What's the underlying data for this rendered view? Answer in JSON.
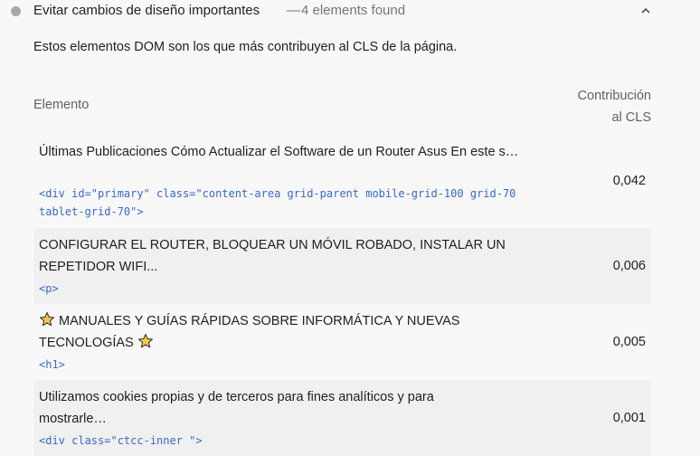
{
  "audit": {
    "title": "Evitar cambios de diseño importantes",
    "separator": "—",
    "count_text": "4 elements found",
    "description": "Estos elementos DOM son los que más contribuyen al CLS de la página."
  },
  "table": {
    "headers": {
      "element": "Elemento",
      "contribution_line1": "Contribución",
      "contribution_line2": "al CLS"
    },
    "rows": [
      {
        "text": "Últimas Publicaciones Cómo Actualizar el Software de un Router Asus En este s…",
        "code": "<div id=\"primary\" class=\"content-area grid-parent mobile-grid-100 grid-70 tablet-grid-70\">",
        "value": "0,042"
      },
      {
        "text": "CONFIGURAR EL ROUTER, BLOQUEAR UN MÓVIL ROBADO, INSTALAR UN REPETIDOR WIFI...",
        "code": "<p>",
        "value": "0,006"
      },
      {
        "text": "MANUALES Y GUÍAS RÁPIDAS SOBRE INFORMÁTICA Y NUEVAS TECNOLOGÍAS",
        "code": "<h1>",
        "value": "0,005",
        "icon": "star-icon"
      },
      {
        "text": "Utilizamos cookies propias y de terceros para fines analíticos y para mostrarle…",
        "code": "<div class=\"ctcc-inner \">",
        "value": "0,001"
      }
    ]
  },
  "colors": {
    "code": "#3a68c8",
    "status_dot": "#a8a8a8",
    "stripe": "#f0f0f0",
    "star": "#f6c84a"
  }
}
